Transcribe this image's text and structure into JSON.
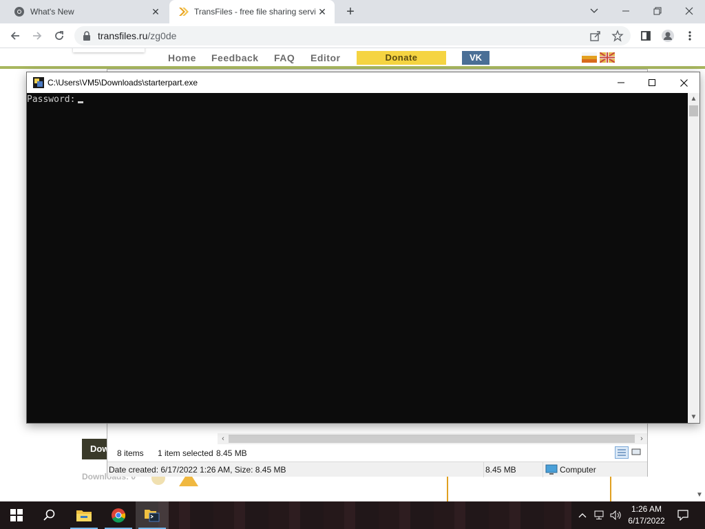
{
  "browser": {
    "tabs": [
      {
        "title": "What's New",
        "icon": "chrome-logo-icon",
        "active": false
      },
      {
        "title": "TransFiles - free file sharing servi",
        "icon": "transfiles-chevron-icon",
        "active": true
      }
    ],
    "address": {
      "host": "transfiles.ru",
      "path": "/zg0de"
    }
  },
  "site": {
    "nav": [
      "Home",
      "Feedback",
      "FAQ",
      "Editor"
    ],
    "donate": "Donate",
    "vk": "VK",
    "download_button": "Dow",
    "downloads_label": "Downloads: 0"
  },
  "console": {
    "title": "C:\\Users\\VM5\\Downloads\\starterpart.exe",
    "prompt": "Password:"
  },
  "explorer": {
    "item_count": "8 items",
    "selected": "1 item selected",
    "selected_size": "8.45 MB",
    "details": "Date created: 6/17/2022 1:26 AM, Size: 8.45 MB",
    "details_size": "8.45 MB",
    "location": "Computer"
  },
  "taskbar": {
    "time": "1:26 AM",
    "date": "6/17/2022",
    "apps": [
      "file-explorer-icon",
      "chrome-icon",
      "console-app-icon"
    ]
  },
  "colors": {
    "donate_bg": "#f5d442",
    "vk_bg": "#4a6f96",
    "console_bg": "#0c0c0c",
    "nav_underline": "#a8b75f"
  }
}
